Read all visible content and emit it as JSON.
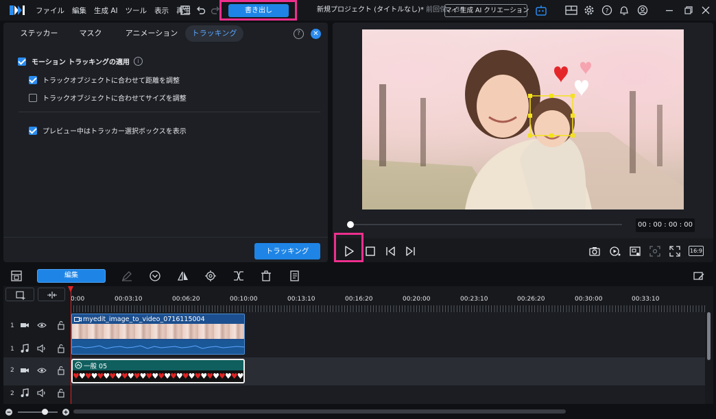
{
  "menu": [
    "ファイル",
    "編集",
    "生成 AI",
    "ツール",
    "表示",
    "再生"
  ],
  "export_label": "書き出し",
  "project": {
    "title": "新規プロジェクト (タイトルなし)*",
    "status": "前回保...:38"
  },
  "ai_creation_label": "マイ 生成 AI クリエーション",
  "tabs": [
    {
      "label": "ステッカー",
      "active": false
    },
    {
      "label": "マスク",
      "active": false
    },
    {
      "label": "アニメーション",
      "active": false
    },
    {
      "label": "トラッキング",
      "active": true
    }
  ],
  "options": {
    "motion_tracking": {
      "label": "モーション トラッキングの適用",
      "checked": true
    },
    "adjust_distance": {
      "label": "トラックオブジェクトに合わせて距離を調整",
      "checked": true
    },
    "adjust_size": {
      "label": "トラックオブジェクトに合わせてサイズを調整",
      "checked": false
    },
    "show_tracker_box": {
      "label": "プレビュー中はトラッカー選択ボックスを表示",
      "checked": true
    }
  },
  "tracking_button": "トラッキング",
  "timecode": "00 : 00 : 00 : 00",
  "aspect_ratio": "16:9",
  "edit_button": "編集",
  "ruler": [
    "0:00",
    "00:03:10",
    "00:06:20",
    "00:10:00",
    "00:13:10",
    "00:16:20",
    "00:20:00",
    "00:23:10",
    "00:26:20",
    "00:30:00",
    "00:33:10"
  ],
  "tracks": [
    {
      "num": "1",
      "type": "video"
    },
    {
      "num": "1",
      "type": "audio"
    },
    {
      "num": "2",
      "type": "video"
    },
    {
      "num": "2",
      "type": "audio"
    }
  ],
  "clips": {
    "video": "myedit_image_to_video_0716115004",
    "title": "一般 05"
  },
  "colors": {
    "accent": "#1e85e6",
    "highlight": "#ee2f8e",
    "playhead": "#e02424"
  }
}
